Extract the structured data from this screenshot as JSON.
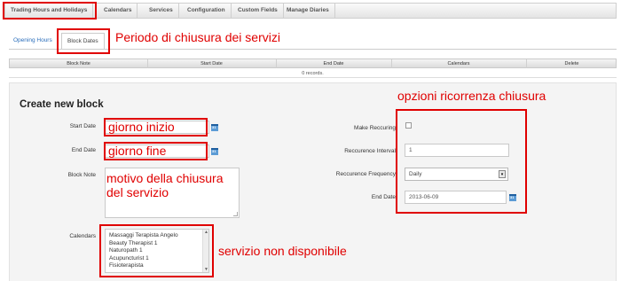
{
  "nav": {
    "tabs": [
      "Trading Hours and Holidays",
      "Calendars",
      "Services",
      "Configuration",
      "Custom Fields",
      "Manage Diaries"
    ]
  },
  "subtabs": {
    "opening_hours": "Opening Hours",
    "block_dates": "Block Dates"
  },
  "table": {
    "columns": [
      "Block Note",
      "Start Date",
      "End Date",
      "Calendars",
      "Delete"
    ],
    "records_text": "0 records."
  },
  "form": {
    "title": "Create new block",
    "start_date_label": "Start Date",
    "end_date_label": "End Date",
    "block_note_label": "Block Note",
    "calendars_label": "Calendars",
    "calendar_options": [
      "Massaggi Terapista Angelo",
      "Beauty Therapist 1",
      "Naturopath 1",
      "Acupuncturist 1",
      "Fisioterapista"
    ],
    "make_recurring_label": "Make Reccuring",
    "recurrence_interval_label": "Reccurence Interval",
    "recurrence_interval_value": "1",
    "recurrence_frequency_label": "Reccurence Frequency",
    "recurrence_frequency_value": "Daily",
    "recurrence_end_date_label": "End Date",
    "recurrence_end_date_value": "2013-06-09"
  },
  "calendar_icon_text": "31",
  "annotations": {
    "periodo": "Periodo di chiusura dei servizi",
    "opzioni": "opzioni ricorrenza chiusura",
    "giorno_inizio": "giorno inizio",
    "giorno_fine": "giorno fine",
    "motivo_line1": "motivo della chiusura",
    "motivo_line2": "del servizio",
    "servizio": "servizio non disponibile"
  },
  "colors": {
    "annotation": "#e00000",
    "link": "#2a6ebb"
  }
}
